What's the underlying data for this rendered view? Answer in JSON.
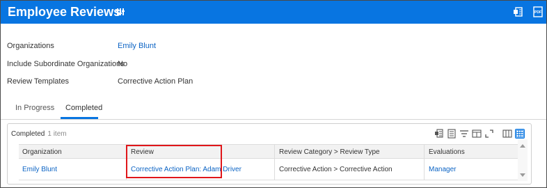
{
  "header": {
    "title": "Employee Reviews",
    "icons": [
      "related-actions-icon",
      "export-excel-icon",
      "export-pdf-icon"
    ],
    "pdf_label": "PDF"
  },
  "params": [
    {
      "label": "Organizations",
      "value": "Emily Blunt",
      "is_link": true
    },
    {
      "label": "Include Subordinate Organizations",
      "value": "No",
      "is_link": false
    },
    {
      "label": "Review Templates",
      "value": "Corrective Action Plan",
      "is_link": false
    }
  ],
  "tabs": [
    {
      "label": "In Progress",
      "active": false
    },
    {
      "label": "Completed",
      "active": true
    }
  ],
  "grid": {
    "title": "Completed",
    "count": "1 item",
    "toolbar_icons": [
      "export-excel-icon",
      "export-pdf-icon",
      "filter-icon",
      "columns-icon",
      "fullscreen-icon",
      "table-view-icon",
      "grid-view-icon"
    ],
    "columns": [
      "Organization",
      "Review",
      "Review Category > Review Type",
      "Evaluations"
    ],
    "rows": [
      [
        "Emily Blunt",
        "Corrective Action Plan: Adam Driver",
        "Corrective Action > Corrective Action",
        "Manager"
      ]
    ]
  },
  "colors": {
    "header_bg": "#0875e1",
    "link": "#0b63c4",
    "highlight": "#e0161a"
  }
}
